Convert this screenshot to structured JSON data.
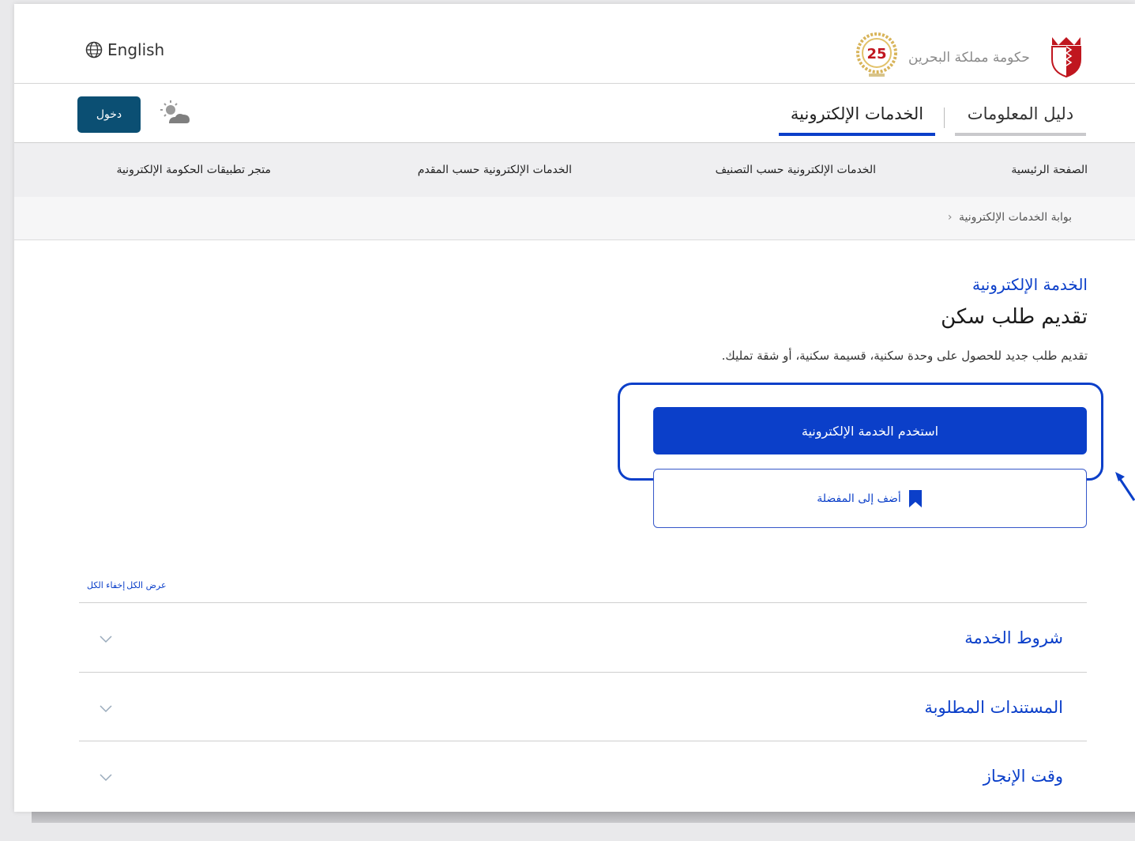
{
  "header": {
    "language_link": "English",
    "brand_name": "حكومة مملكة البحرين",
    "anniversary_badge": "25"
  },
  "tabs": {
    "info_guide": "دليل المعلومات",
    "eservices": "الخدمات الإلكترونية",
    "login": "دخول"
  },
  "nav": {
    "items": [
      "الصفحة الرئيسية",
      "الخدمات الإلكترونية حسب التصنيف",
      "الخدمات الإلكترونية حسب المقدم",
      "متجر تطبيقات الحكومة الإلكترونية"
    ]
  },
  "breadcrumb": {
    "item": "بوابة الخدمات الإلكترونية"
  },
  "service": {
    "eyebrow": "الخدمة الإلكترونية",
    "title": "تقديم طلب سكن",
    "description": "تقديم طلب جديد للحصول على وحدة سكنية، قسيمة سكنية، أو شقة تمليك.",
    "use_button": "استخدم الخدمة الإلكترونية",
    "favorite_button": "أضف إلى المفضلة"
  },
  "accordion": {
    "show_all": "عرض الكل",
    "hide_all": "إخفاء الكل",
    "sections": [
      "شروط الخدمة",
      "المستندات المطلوبة",
      "وقت الإنجاز"
    ]
  },
  "colors": {
    "accent": "#0b3fc9",
    "login_bg": "#0b4f73",
    "nav_bg": "#efeff1"
  }
}
